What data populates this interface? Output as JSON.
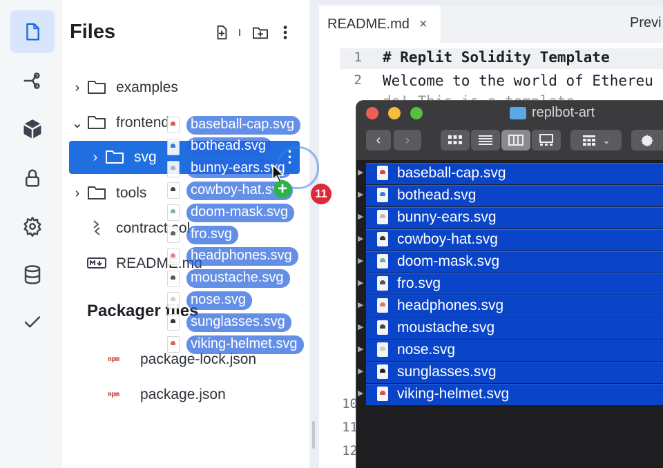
{
  "files_panel": {
    "title": "Files",
    "tree": [
      {
        "chevron": "›",
        "name": "examples"
      },
      {
        "chevron": "⌄",
        "name": "frontend"
      },
      {
        "chevron": "›",
        "name": "svg"
      },
      {
        "chevron": "›",
        "name": "tools"
      },
      {
        "chevron": "",
        "name": "contract.sol"
      },
      {
        "chevron": "",
        "name": "README.md"
      }
    ],
    "packager_title": "Packager files",
    "packager_files": [
      {
        "badge": "npm",
        "name": "package-lock.json"
      },
      {
        "badge": "npm",
        "name": "package.json"
      }
    ]
  },
  "rail_icons": [
    "files-icon",
    "git-icon",
    "packages-icon",
    "secrets-icon",
    "settings-icon",
    "database-icon",
    "check-icon"
  ],
  "editor": {
    "tab": "README.md",
    "tab_close": "×",
    "preview_tab": "Previ",
    "lines": [
      {
        "num": "1",
        "text": "# Replit Solidity Template"
      },
      {
        "num": "2",
        "text": "Welcome to the world of Ethereu"
      }
    ],
    "partial_line": "ds! This is a template",
    "hidden_line_numbers": [
      "10",
      "11",
      "12"
    ]
  },
  "finder": {
    "title": "replbot-art",
    "files": [
      "baseball-cap.svg",
      "bothead.svg",
      "bunny-ears.svg",
      "cowboy-hat.svg",
      "doom-mask.svg",
      "fro.svg",
      "headphones.svg",
      "moustache.svg",
      "nose.svg",
      "sunglasses.svg",
      "viking-helmet.svg"
    ]
  },
  "drag": {
    "files": [
      "baseball-cap.svg",
      "bothead.svg",
      "bunny-ears.svg",
      "cowboy-hat.svg",
      "doom-mask.svg",
      "fro.svg",
      "headphones.svg",
      "moustache.svg",
      "nose.svg",
      "sunglasses.svg",
      "viking-helmet.svg"
    ],
    "count": "11",
    "plus": "+"
  },
  "colors": {
    "accent": "#1f6fe0",
    "finder_selection": "#0a44c8",
    "badge": "#e0283a",
    "plus": "#2cb34a"
  }
}
